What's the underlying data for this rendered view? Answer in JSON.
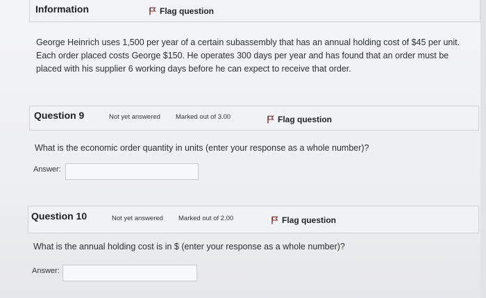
{
  "information": {
    "title": "Information",
    "flag_label": "Flag question",
    "text": "George Heinrich uses 1,500 per year of a certain subassembly that has an annual holding cost of $45 per unit. Each order placed costs George $150. He operates 300 days per year and has found that an order must be placed with his supplier 6 working days before he can expect to receive that order."
  },
  "questions": [
    {
      "title": "Question 9",
      "status": "Not yet answered",
      "marks": "Marked out of 3.00",
      "flag_label": "Flag question",
      "text": "What is the economic order quantity in units (enter your response as a whole number)?",
      "answer_label": "Answer:",
      "answer_value": ""
    },
    {
      "title": "Question 10",
      "status": "Not yet answered",
      "marks": "Marked out of 2.00",
      "flag_label": "Flag question",
      "text": "What is the annual holding cost is in $ (enter your response as a whole number)?",
      "answer_label": "Answer:",
      "answer_value": ""
    }
  ],
  "colors": {
    "flag_icon": "#7a2a2a"
  },
  "icons": {
    "flag": "flag-icon"
  }
}
